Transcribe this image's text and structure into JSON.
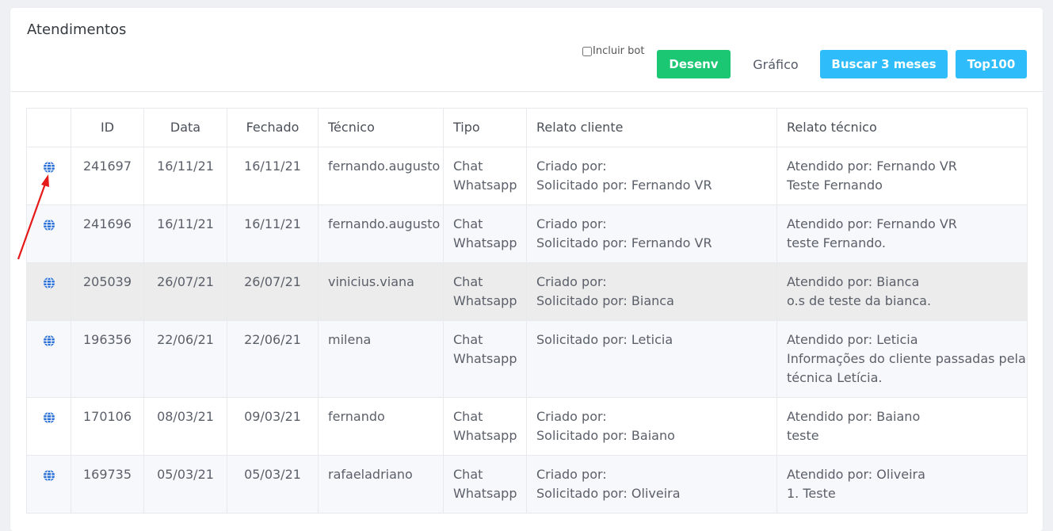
{
  "header": {
    "title": "Atendimentos",
    "include_bot_label": "Incluir bot",
    "buttons": {
      "desenv": "Desenv",
      "grafico": "Gráfico",
      "buscar": "Buscar 3 meses",
      "top100": "Top100"
    }
  },
  "colors": {
    "green": "#1bc773",
    "blue": "#2ebdfa",
    "globe": "#2a6fd6",
    "arrow": "#e61919"
  },
  "table": {
    "columns": [
      "",
      "ID",
      "Data",
      "Fechado",
      "Técnico",
      "Tipo",
      "Relato cliente",
      "Relato técnico"
    ],
    "rows": [
      {
        "id": "241697",
        "data": "16/11/21",
        "fechado": "16/11/21",
        "tecnico": "fernando.augusto",
        "tipo": [
          "Chat",
          "Whatsapp"
        ],
        "cliente": [
          "Criado por:",
          "Solicitado por: Fernando VR"
        ],
        "relato": [
          "Atendido por: Fernando VR",
          "Teste Fernando"
        ]
      },
      {
        "id": "241696",
        "data": "16/11/21",
        "fechado": "16/11/21",
        "tecnico": "fernando.augusto",
        "tipo": [
          "Chat",
          "Whatsapp"
        ],
        "cliente": [
          "Criado por:",
          "Solicitado por: Fernando VR"
        ],
        "relato": [
          "Atendido por: Fernando VR",
          "teste Fernando."
        ]
      },
      {
        "id": "205039",
        "data": "26/07/21",
        "fechado": "26/07/21",
        "tecnico": "vinicius.viana",
        "tipo": [
          "Chat",
          "Whatsapp"
        ],
        "cliente": [
          "Criado por:",
          "Solicitado por: Bianca"
        ],
        "relato": [
          "Atendido por: Bianca",
          "o.s de teste da bianca."
        ]
      },
      {
        "id": "196356",
        "data": "22/06/21",
        "fechado": "22/06/21",
        "tecnico": "milena",
        "tipo": [
          "Chat",
          "Whatsapp"
        ],
        "cliente": [
          "Solicitado por: Leticia",
          ""
        ],
        "relato": [
          "Atendido por: Leticia",
          "Informações do cliente passadas pela",
          "técnica Letícia."
        ]
      },
      {
        "id": "170106",
        "data": "08/03/21",
        "fechado": "09/03/21",
        "tecnico": "fernando",
        "tipo": [
          "Chat",
          "Whatsapp"
        ],
        "cliente": [
          "Criado por:",
          "Solicitado por: Baiano"
        ],
        "relato": [
          "Atendido por: Baiano",
          "teste"
        ]
      },
      {
        "id": "169735",
        "data": "05/03/21",
        "fechado": "05/03/21",
        "tecnico": "rafaeladriano",
        "tipo": [
          "Chat",
          "Whatsapp"
        ],
        "cliente": [
          "Criado por:",
          "Solicitado por: Oliveira"
        ],
        "relato": [
          "Atendido por: Oliveira",
          "1. Teste"
        ]
      }
    ]
  }
}
